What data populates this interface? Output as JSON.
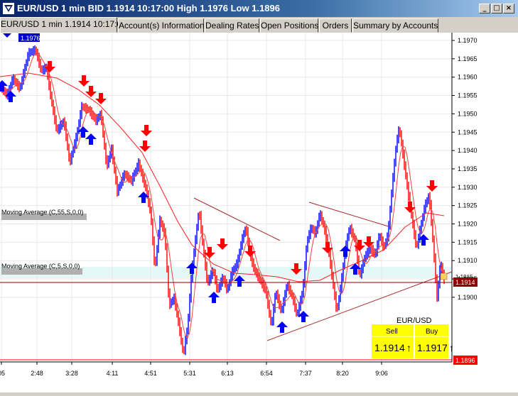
{
  "window": {
    "title": "EUR/USD 1 min BID 1.1914 10:17:00 High 1.1976 Low 1.1896",
    "buttons": [
      "_",
      "□",
      "×"
    ]
  },
  "tabs": [
    {
      "label": "EUR/USD 1 min 1.1914 10:17:00",
      "active": true
    },
    {
      "label": "Account(s) Information",
      "active": false
    },
    {
      "label": "Dealing Rates",
      "active": false
    },
    {
      "label": "Open Positions",
      "active": false
    },
    {
      "label": "Orders",
      "active": false
    },
    {
      "label": "Summary by Accounts",
      "active": false
    }
  ],
  "chart": {
    "high_marker": "1.1976",
    "indicator_labels": [
      "Moving Average (C,55,S,0,0)",
      "Moving Average (C,5,S,0,0)"
    ],
    "current_price_label": "1.1914",
    "low_price_label": "1.1896",
    "current_marker_label": "1.1915",
    "y_ticks": [
      "1.1970",
      "1.1965",
      "1.1960",
      "1.1955",
      "1.1950",
      "1.1945",
      "1.1940",
      "1.1935",
      "1.1930",
      "1.1925",
      "1.1920",
      "1.1915",
      "1.1910",
      "1.1905",
      "1.1900"
    ],
    "x_ticks": [
      "05",
      "2:48",
      "3:28",
      "4:11",
      "4:51",
      "5:31",
      "6:13",
      "6:54",
      "7:37",
      "8:20",
      "9:06"
    ],
    "colors": {
      "background": "#ffffff",
      "up": "#0000ff",
      "down": "#ff0000",
      "ma": "#ff0000",
      "trendline": "#a52a2a",
      "price_line": "#8b0000",
      "quote_box": "#ffff00"
    }
  },
  "quote": {
    "symbol": "EUR/USD",
    "sell_label": "Sell",
    "buy_label": "Buy",
    "sell_price": "1.1914",
    "buy_price": "1.1917",
    "arrow": "↑"
  }
}
